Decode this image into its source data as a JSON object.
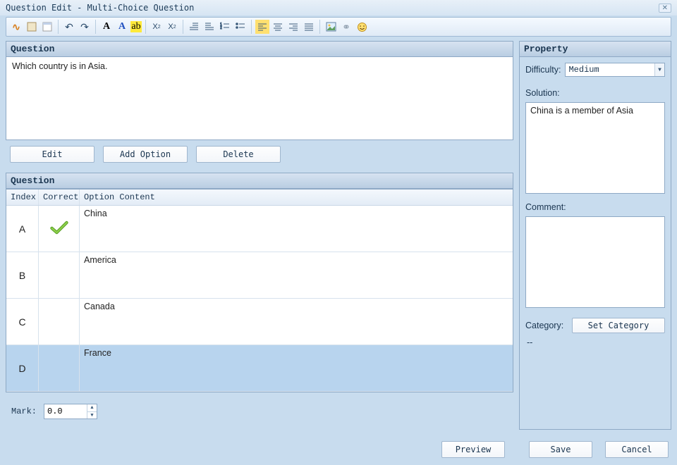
{
  "window": {
    "title": "Question Edit - Multi-Choice Question"
  },
  "question_panel": {
    "header": "Question",
    "text": "Which country is in Asia."
  },
  "buttons": {
    "edit": "Edit",
    "add_option": "Add Option",
    "delete": "Delete",
    "preview": "Preview",
    "save": "Save",
    "cancel": "Cancel",
    "set_category": "Set Category"
  },
  "options_panel": {
    "header": "Question",
    "col_index": "Index",
    "col_correct": "Correct",
    "col_content": "Option Content",
    "rows": [
      {
        "idx": "A",
        "correct": true,
        "content": "China",
        "selected": false
      },
      {
        "idx": "B",
        "correct": false,
        "content": "America",
        "selected": false
      },
      {
        "idx": "C",
        "correct": false,
        "content": "Canada",
        "selected": false
      },
      {
        "idx": "D",
        "correct": false,
        "content": "France",
        "selected": true
      }
    ]
  },
  "mark": {
    "label": "Mark:",
    "value": "0.0"
  },
  "property": {
    "header": "Property",
    "difficulty_label": "Difficulty:",
    "difficulty_value": "Medium",
    "solution_label": "Solution:",
    "solution_value": "China is a member of Asia",
    "comment_label": "Comment:",
    "comment_value": "",
    "category_label": "Category:",
    "category_value": "--"
  }
}
